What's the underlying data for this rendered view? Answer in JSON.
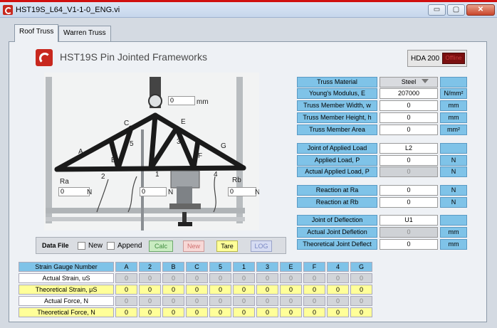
{
  "window": {
    "title": "HST19S_L64_V1-1-0_ENG.vi",
    "min": "▭",
    "max": "▢",
    "close": "✕"
  },
  "tabs": [
    {
      "label": "Roof Truss"
    },
    {
      "label": "Warren Truss"
    }
  ],
  "header": {
    "title": "HST19S  Pin Jointed Frameworks",
    "hda_label": "HDA 200",
    "hda_indicator": "Offline"
  },
  "photo": {
    "dial_value": "0",
    "dial_unit": "mm",
    "ra_value": "0",
    "ra_unit": "N",
    "mid_value": "0",
    "mid_unit": "N",
    "rb_value": "0",
    "rb_unit": "N",
    "labels": {
      "a": "A",
      "b": "B",
      "c": "C",
      "e": "E",
      "f": "F",
      "g": "G",
      "n1": "1",
      "n2": "2",
      "n3": "3",
      "n4": "4",
      "n5": "5",
      "ra": "Ra",
      "rb": "Rb"
    }
  },
  "properties": [
    {
      "label": "Truss Material",
      "value": "Steel",
      "unit": "",
      "type": "select"
    },
    {
      "label": "Young's Modulus, E",
      "value": "207000",
      "unit": "N/mm²"
    },
    {
      "label": "Truss Member Width, w",
      "value": "0",
      "unit": "mm"
    },
    {
      "label": "Truss Member Height, h",
      "value": "0",
      "unit": "mm"
    },
    {
      "label": "Truss Member Area",
      "value": "0",
      "unit": "mm²"
    },
    {
      "label": "Joint of Applied Load",
      "value": "L2",
      "unit": ""
    },
    {
      "label": "Applied Load, P",
      "value": "0",
      "unit": "N"
    },
    {
      "label": "Actual Applied Load, P",
      "value": "0",
      "unit": "N",
      "readonly": true
    },
    {
      "label": "Reaction at Ra",
      "value": "0",
      "unit": "N"
    },
    {
      "label": "Reaction at Rb",
      "value": "0",
      "unit": "N"
    },
    {
      "label": "Joint of Deflection",
      "value": "U1",
      "unit": ""
    },
    {
      "label": "Actual Joint Defletion",
      "value": "0",
      "unit": "mm",
      "readonly": true
    },
    {
      "label": "Theoretical Joint Deflect",
      "value": "0",
      "unit": "mm"
    }
  ],
  "datafile": {
    "label": "Data File",
    "new_check": "New",
    "append_check": "Append",
    "calc": "Calc",
    "new_btn": "New",
    "tare": "Tare",
    "log": "LOG"
  },
  "strain_table": {
    "header": [
      "Strain Gauge Number",
      "A",
      "2",
      "B",
      "C",
      "5",
      "1",
      "3",
      "E",
      "F",
      "4",
      "G"
    ],
    "rows": [
      {
        "label": "Actual Strain, uS",
        "values": [
          "0",
          "0",
          "0",
          "0",
          "0",
          "0",
          "0",
          "0",
          "0",
          "0",
          "0"
        ]
      },
      {
        "label": "Theoretical Strain, μS",
        "values": [
          "0",
          "0",
          "0",
          "0",
          "0",
          "0",
          "0",
          "0",
          "0",
          "0",
          "0"
        ]
      },
      {
        "label": "Actual Force, N",
        "values": [
          "0",
          "0",
          "0",
          "0",
          "0",
          "0",
          "0",
          "0",
          "0",
          "0",
          "0"
        ]
      },
      {
        "label": "Theoretical Force, N",
        "values": [
          "0",
          "0",
          "0",
          "0",
          "0",
          "0",
          "0",
          "0",
          "0",
          "0",
          "0"
        ]
      }
    ]
  },
  "colors": {
    "accent": "#7fc3e8",
    "brand": "#c8281e",
    "yellow": "#ffff99",
    "grey": "#d2d5d9"
  }
}
